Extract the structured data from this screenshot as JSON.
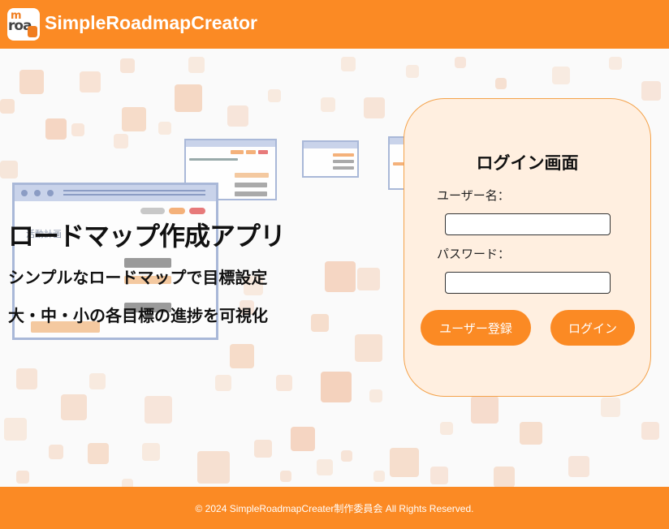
{
  "header": {
    "app_title": "SimpleRoadmapCreator",
    "logo_text_top": "m",
    "logo_text_bottom": "roa"
  },
  "hero": {
    "title": "ロードマップ作成アプリ",
    "subtitle_1": "シンプルなロードマップで目標設定",
    "subtitle_2": "大・中・小の各目標の進捗を可視化"
  },
  "illustration": {
    "window_heading": "活動計画"
  },
  "login": {
    "title": "ログイン画面",
    "username_label": "ユーザー名：",
    "username_value": "",
    "password_label": "パスワード：",
    "password_value": "",
    "register_button": "ユーザー登録",
    "login_button": "ログイン"
  },
  "footer": {
    "copyright": "© 2024 SimpleRoadmapCreater制作委員会 All Rights Reserved."
  },
  "colors": {
    "brand_orange": "#fb8a24",
    "panel_bg": "#ffefe0",
    "panel_border": "#f4a24a"
  }
}
